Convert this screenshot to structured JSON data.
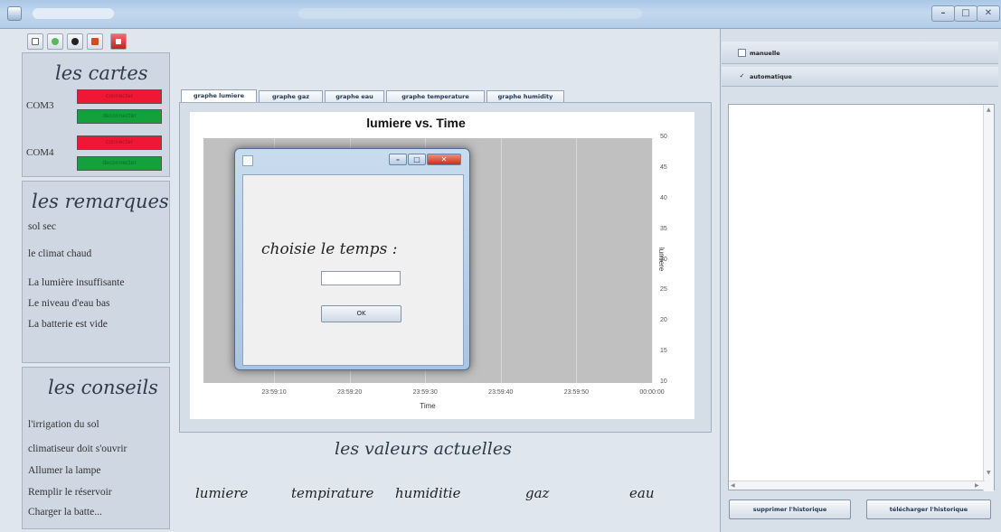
{
  "window": {
    "controls": {
      "minimize": "–",
      "maximize": "□",
      "close": "✕"
    }
  },
  "toolbar": {
    "icons": [
      "window-icon",
      "earth-icon",
      "record-icon",
      "flag-icon",
      "close-icon"
    ]
  },
  "cartes": {
    "title": "les cartes",
    "ports": [
      {
        "name": "COM3",
        "connect_label": "connecter",
        "disconnect_label": "deconnecter"
      },
      {
        "name": "COM4",
        "connect_label": "connecter",
        "disconnect_label": "deconnecter"
      }
    ]
  },
  "remarques": {
    "title": "les remarques",
    "items": [
      "sol sec",
      "le climat chaud",
      "La lumière insuffisante",
      "Le niveau d'eau bas",
      "La batterie est vide"
    ]
  },
  "conseils": {
    "title": "les conseils",
    "items": [
      "l'irrigation du sol",
      "climatiseur doit s'ouvrir",
      "Allumer la lampe",
      "Remplir le réservoir",
      "Charger la batte..."
    ]
  },
  "tabs": [
    "graphe lumiere",
    "graphe gaz",
    "graphe eau",
    "graphe temperature",
    "graphe humidity"
  ],
  "active_tab": 0,
  "chart_data": {
    "type": "line",
    "title": "lumiere vs. Time",
    "xlabel": "Time",
    "ylabel": "lumiere",
    "x_ticks": [
      "23:59:10",
      "23:59:20",
      "23:59:30",
      "23:59:40",
      "23:59:50",
      "00:00:00"
    ],
    "y_ticks": [
      50,
      45,
      40,
      35,
      30,
      25,
      20,
      15,
      10
    ],
    "ylim": [
      10,
      50
    ],
    "y_axis_side": "right",
    "series": [],
    "background_color": "#c0c0c0"
  },
  "dialog": {
    "prompt": "choisie le temps :",
    "input_value": "",
    "ok_label": "OK",
    "controls": {
      "minimize": "–",
      "maximize": "□",
      "close": "✕"
    }
  },
  "valeurs": {
    "title": "les valeurs actuelles",
    "labels": [
      "lumiere",
      "tempirature",
      "humiditie",
      "gaz",
      "eau"
    ]
  },
  "mode": {
    "manuelle": {
      "label": "manuelle",
      "checked": false
    },
    "automatique": {
      "label": "automatique",
      "checked": true
    }
  },
  "historique": {
    "text": "",
    "delete_label": "supprimer l'historique",
    "download_label": "télécharger l'historique"
  },
  "colors": {
    "connect_red": "#ee1836",
    "disconnect_green": "#12a13b",
    "plot_gray": "#c0c0c0"
  }
}
